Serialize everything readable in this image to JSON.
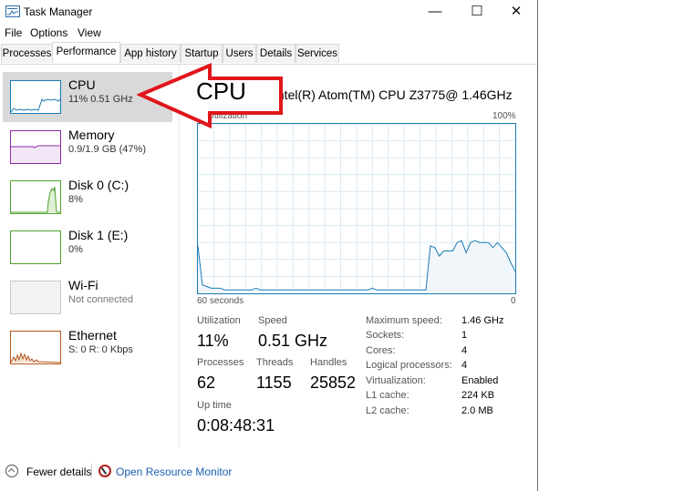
{
  "window": {
    "title": "Task Manager",
    "minimize": "—",
    "maximize": "☐",
    "close": "✕"
  },
  "menu": [
    "File",
    "Options",
    "View"
  ],
  "tabs": [
    "Processes",
    "Performance",
    "App history",
    "Startup",
    "Users",
    "Details",
    "Services"
  ],
  "active_tab": "Performance",
  "sidebar": [
    {
      "name": "CPU",
      "sub": "11% 0.51 GHz",
      "color": "#1a7ab5"
    },
    {
      "name": "Memory",
      "sub": "0.9/1.9 GB (47%)",
      "color": "#8b2aa7"
    },
    {
      "name": "Disk 0 (C:)",
      "sub": "8%",
      "color": "#4da22b"
    },
    {
      "name": "Disk 1 (E:)",
      "sub": "0%",
      "color": "#4da22b"
    },
    {
      "name": "Wi-Fi",
      "sub": "Not connected",
      "color": "#c8c8c8"
    },
    {
      "name": "Ethernet",
      "sub": "S: 0 R: 0 Kbps",
      "color": "#b3581b"
    }
  ],
  "annotation": {
    "label": "CPU",
    "arrow_color": "#e0161b"
  },
  "main": {
    "heading": "CPU",
    "model": "Intel(R) Atom(TM) CPU Z3775@ 1.46GHz",
    "graph_label": "% Utilization",
    "graph_max": "100%",
    "time_left": "60 seconds",
    "time_right": "0",
    "graph_color": "#1a7ab5",
    "utilization_series": [
      28,
      5,
      4,
      3,
      3,
      3,
      2,
      2,
      2,
      2,
      2,
      2,
      2,
      3,
      2,
      2,
      2,
      2,
      2,
      2,
      2,
      2,
      2,
      2,
      2,
      2,
      2,
      2,
      2,
      2,
      2,
      2,
      2,
      2,
      2,
      2,
      2,
      2,
      2,
      3,
      2,
      2,
      2,
      2,
      2,
      2,
      2,
      2,
      2,
      2,
      2,
      2,
      28,
      27,
      22,
      25,
      25,
      25,
      30,
      31,
      24,
      30,
      31,
      30,
      30,
      30,
      27,
      30,
      27,
      24,
      18,
      13
    ]
  },
  "stats": {
    "utilization_label": "Utilization",
    "utilization": "11%",
    "speed_label": "Speed",
    "speed": "0.51 GHz",
    "processes_label": "Processes",
    "processes": "62",
    "threads_label": "Threads",
    "threads": "1155",
    "handles_label": "Handles",
    "handles": "25852",
    "uptime_label": "Up time",
    "uptime": "0:08:48:31"
  },
  "details": [
    {
      "key": "Maximum speed:",
      "value": "1.46 GHz"
    },
    {
      "key": "Sockets:",
      "value": "1"
    },
    {
      "key": "Cores:",
      "value": "4"
    },
    {
      "key": "Logical processors:",
      "value": "4"
    },
    {
      "key": "Virtualization:",
      "value": "Enabled"
    },
    {
      "key": "L1 cache:",
      "value": "224 KB"
    },
    {
      "key": "L2 cache:",
      "value": "2.0 MB"
    }
  ],
  "footer": {
    "fewer": "Fewer details",
    "monitor": "Open Resource Monitor"
  }
}
